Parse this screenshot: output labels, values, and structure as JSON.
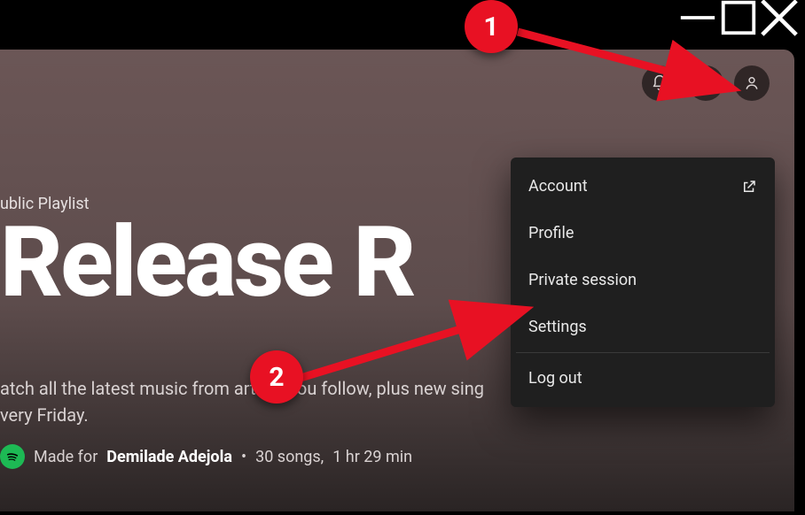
{
  "window": {
    "minimize": "—",
    "maximize": "▢",
    "close": "×"
  },
  "header": {
    "subtitle": "ublic Playlist",
    "title": "Release R"
  },
  "description": {
    "line1": "atch all the latest music from artists you follow, plus new sing",
    "line2": "very Friday."
  },
  "meta": {
    "made_for_label": "Made for",
    "user": "Demilade Adejola",
    "separator": "•",
    "songs": "30 songs,",
    "duration": "1 hr 29 min"
  },
  "dropdown": {
    "items": [
      {
        "label": "Account",
        "external": true
      },
      {
        "label": "Profile",
        "external": false
      },
      {
        "label": "Private session",
        "external": false
      },
      {
        "label": "Settings",
        "external": false
      },
      {
        "label": "Log out",
        "external": false
      }
    ]
  },
  "annotations": {
    "badge1": "1",
    "badge2": "2"
  }
}
